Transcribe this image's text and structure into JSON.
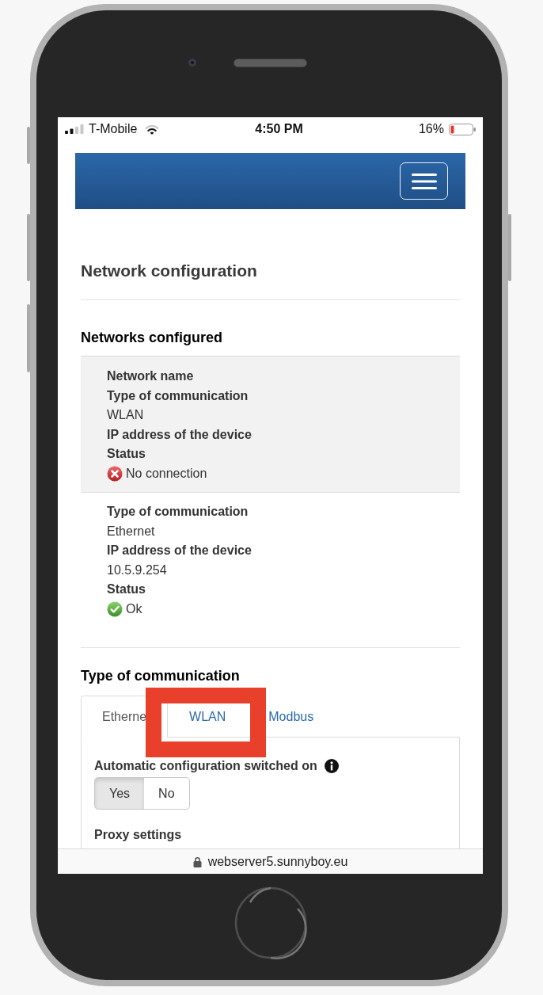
{
  "status_bar": {
    "carrier": "T-Mobile",
    "time": "4:50 PM",
    "battery": "16%"
  },
  "page_title": "Network configuration",
  "networks_section": {
    "title": "Networks configured",
    "networks": [
      {
        "selected": true,
        "fields": [
          {
            "kind": "plain",
            "label": "Network name"
          },
          {
            "kind": "plain",
            "label": "Type of communication",
            "value": "WLAN"
          },
          {
            "kind": "plain",
            "label": "IP address of the device"
          },
          {
            "kind": "status",
            "label": "Status",
            "value": "No connection",
            "ok": false
          }
        ]
      },
      {
        "selected": false,
        "fields": [
          {
            "kind": "plain",
            "label": "Type of communication",
            "value": "Ethernet"
          },
          {
            "kind": "plain",
            "label": "IP address of the device",
            "value": "10.5.9.254"
          },
          {
            "kind": "status",
            "label": "Status",
            "value": "Ok",
            "ok": true
          }
        ]
      }
    ]
  },
  "communication_section": {
    "title": "Type of communication",
    "tabs": [
      {
        "label": "Etherne",
        "selected": true,
        "highlighted": false
      },
      {
        "label": "WLAN",
        "selected": false,
        "highlighted": true
      },
      {
        "label": "Modbus",
        "selected": false,
        "highlighted": false
      }
    ],
    "auto_configuration": {
      "label": "Automatic configuration switched on",
      "options": [
        {
          "label": "Yes",
          "selected": true
        },
        {
          "label": "No",
          "selected": false
        }
      ]
    },
    "proxy_settings": {
      "label": "Proxy settings"
    }
  },
  "url_bar": {
    "url": "webserver5.sunnyboy.eu",
    "secure": true
  }
}
